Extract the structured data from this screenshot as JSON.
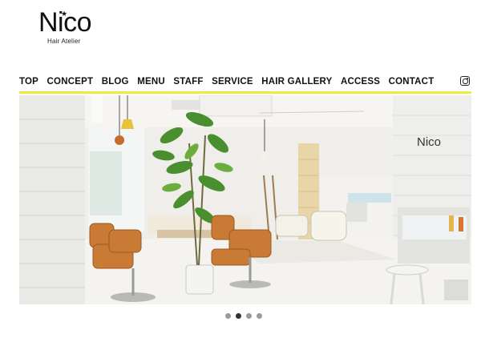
{
  "logo": {
    "name": "Nico",
    "star": "★",
    "subtitle": "Hair Atelier"
  },
  "nav": {
    "items": [
      {
        "label": "TOP"
      },
      {
        "label": "CONCEPT"
      },
      {
        "label": "BLOG"
      },
      {
        "label": "MENU"
      },
      {
        "label": "STAFF"
      },
      {
        "label": "SERVICE"
      },
      {
        "label": "HAIR GALLERY"
      },
      {
        "label": "ACCESS"
      },
      {
        "label": "CONTACT"
      }
    ],
    "social_icon": "instagram-icon",
    "underline_color": "#f0ea3a"
  },
  "hero": {
    "wall_sign": "Nico",
    "slide_count": 4,
    "active_slide": 2
  }
}
